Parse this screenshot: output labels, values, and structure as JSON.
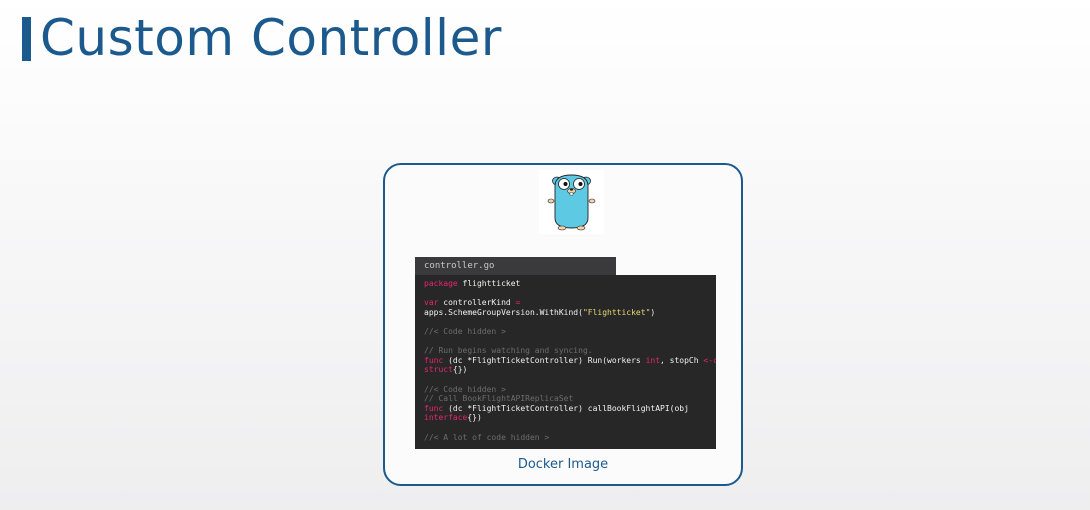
{
  "slide": {
    "title": "Custom Controller",
    "accent_color": "#1c5a8e"
  },
  "card": {
    "image_icon": "go-gopher-icon",
    "caption": "Docker Image"
  },
  "code": {
    "filename": "controller.go",
    "lines": [
      [
        {
          "t": "kw",
          "v": "package"
        },
        {
          "t": "pl",
          "v": " flightticket"
        }
      ],
      [],
      [
        {
          "t": "kw",
          "v": "var"
        },
        {
          "t": "pl",
          "v": " controllerKind "
        },
        {
          "t": "kw",
          "v": "="
        }
      ],
      [
        {
          "t": "pl",
          "v": "apps.SchemeGroupVersion.WithKind("
        },
        {
          "t": "str",
          "v": "\"Flightticket\""
        },
        {
          "t": "pl",
          "v": ")"
        }
      ],
      [],
      [
        {
          "t": "cm",
          "v": "//< Code hidden >"
        }
      ],
      [],
      [
        {
          "t": "cm",
          "v": "// Run begins watching and syncing."
        }
      ],
      [
        {
          "t": "kw",
          "v": "func"
        },
        {
          "t": "pl",
          "v": " (dc *FlightTicketController) Run(workers "
        },
        {
          "t": "kw",
          "v": "int"
        },
        {
          "t": "pl",
          "v": ", stopCh "
        },
        {
          "t": "kw",
          "v": "<-chan"
        }
      ],
      [
        {
          "t": "kw",
          "v": "struct"
        },
        {
          "t": "pl",
          "v": "{})"
        }
      ],
      [],
      [
        {
          "t": "cm",
          "v": "//< Code hidden >"
        }
      ],
      [
        {
          "t": "cm",
          "v": "// Call BookFlightAPIReplicaSet"
        }
      ],
      [
        {
          "t": "kw",
          "v": "func"
        },
        {
          "t": "pl",
          "v": " (dc *FlightTicketController) callBookFlightAPI(obj"
        }
      ],
      [
        {
          "t": "kw",
          "v": "interface"
        },
        {
          "t": "pl",
          "v": "{})"
        }
      ],
      [],
      [
        {
          "t": "cm",
          "v": "//< A lot of code hidden >"
        }
      ]
    ]
  }
}
